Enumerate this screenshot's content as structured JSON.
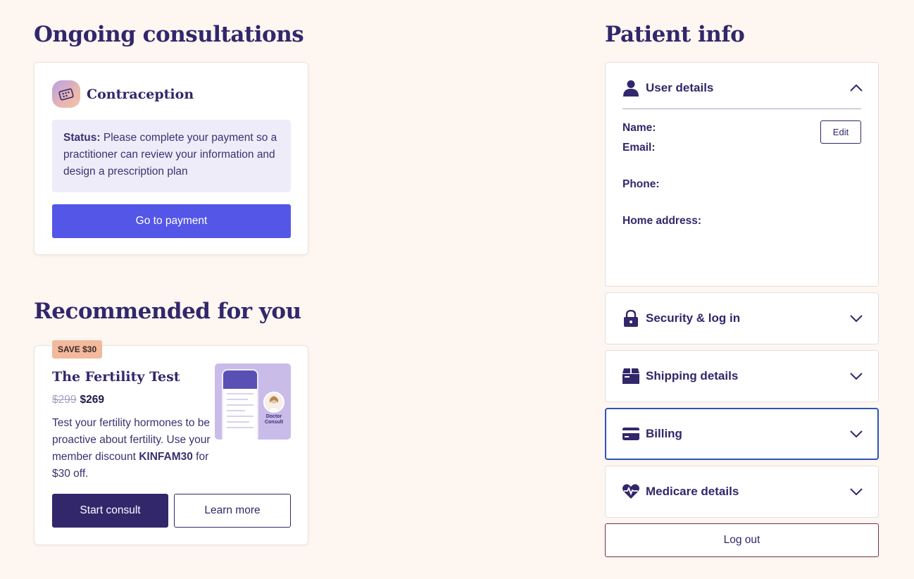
{
  "ongoing": {
    "heading": "Ongoing consultations",
    "card": {
      "icon": "pill-pack-icon",
      "title": "Contraception",
      "status_label": "Status:",
      "status_text": "Please complete your payment so a practitioner can review your information and design a prescription plan",
      "button": "Go to payment"
    }
  },
  "recommended": {
    "heading": "Recommended for you",
    "card": {
      "tag": "SAVE $30",
      "title": "The Fertility Test",
      "price_old": "$299",
      "price_new": "$269",
      "desc_before": "Test your fertility hormones to be proactive about fertility. Use your member discount",
      "discount_code": "KINFAM30",
      "desc_after": "for $30 off.",
      "image_caption": "Doctor Consult",
      "primary_button": "Start consult",
      "secondary_button": "Learn more"
    }
  },
  "patient": {
    "heading": "Patient info",
    "user_details": {
      "label": "User details",
      "icon": "user-icon",
      "expanded": true,
      "name_label": "Name:",
      "email_label": "Email:",
      "phone_label": "Phone:",
      "address_label": "Home address:",
      "edit_button": "Edit"
    },
    "sections": [
      {
        "label": "Security & log in",
        "icon": "lock-icon"
      },
      {
        "label": "Shipping details",
        "icon": "box-icon"
      },
      {
        "label": "Billing",
        "icon": "credit-card-icon"
      },
      {
        "label": "Medicare details",
        "icon": "heart-pulse-icon"
      }
    ],
    "logout_button": "Log out"
  },
  "colors": {
    "background": "#fdf6f1",
    "primary_text": "#32276b",
    "accent_button": "#5356e6",
    "status_bg": "#efecfa",
    "tag_bg": "#f3b99c"
  }
}
